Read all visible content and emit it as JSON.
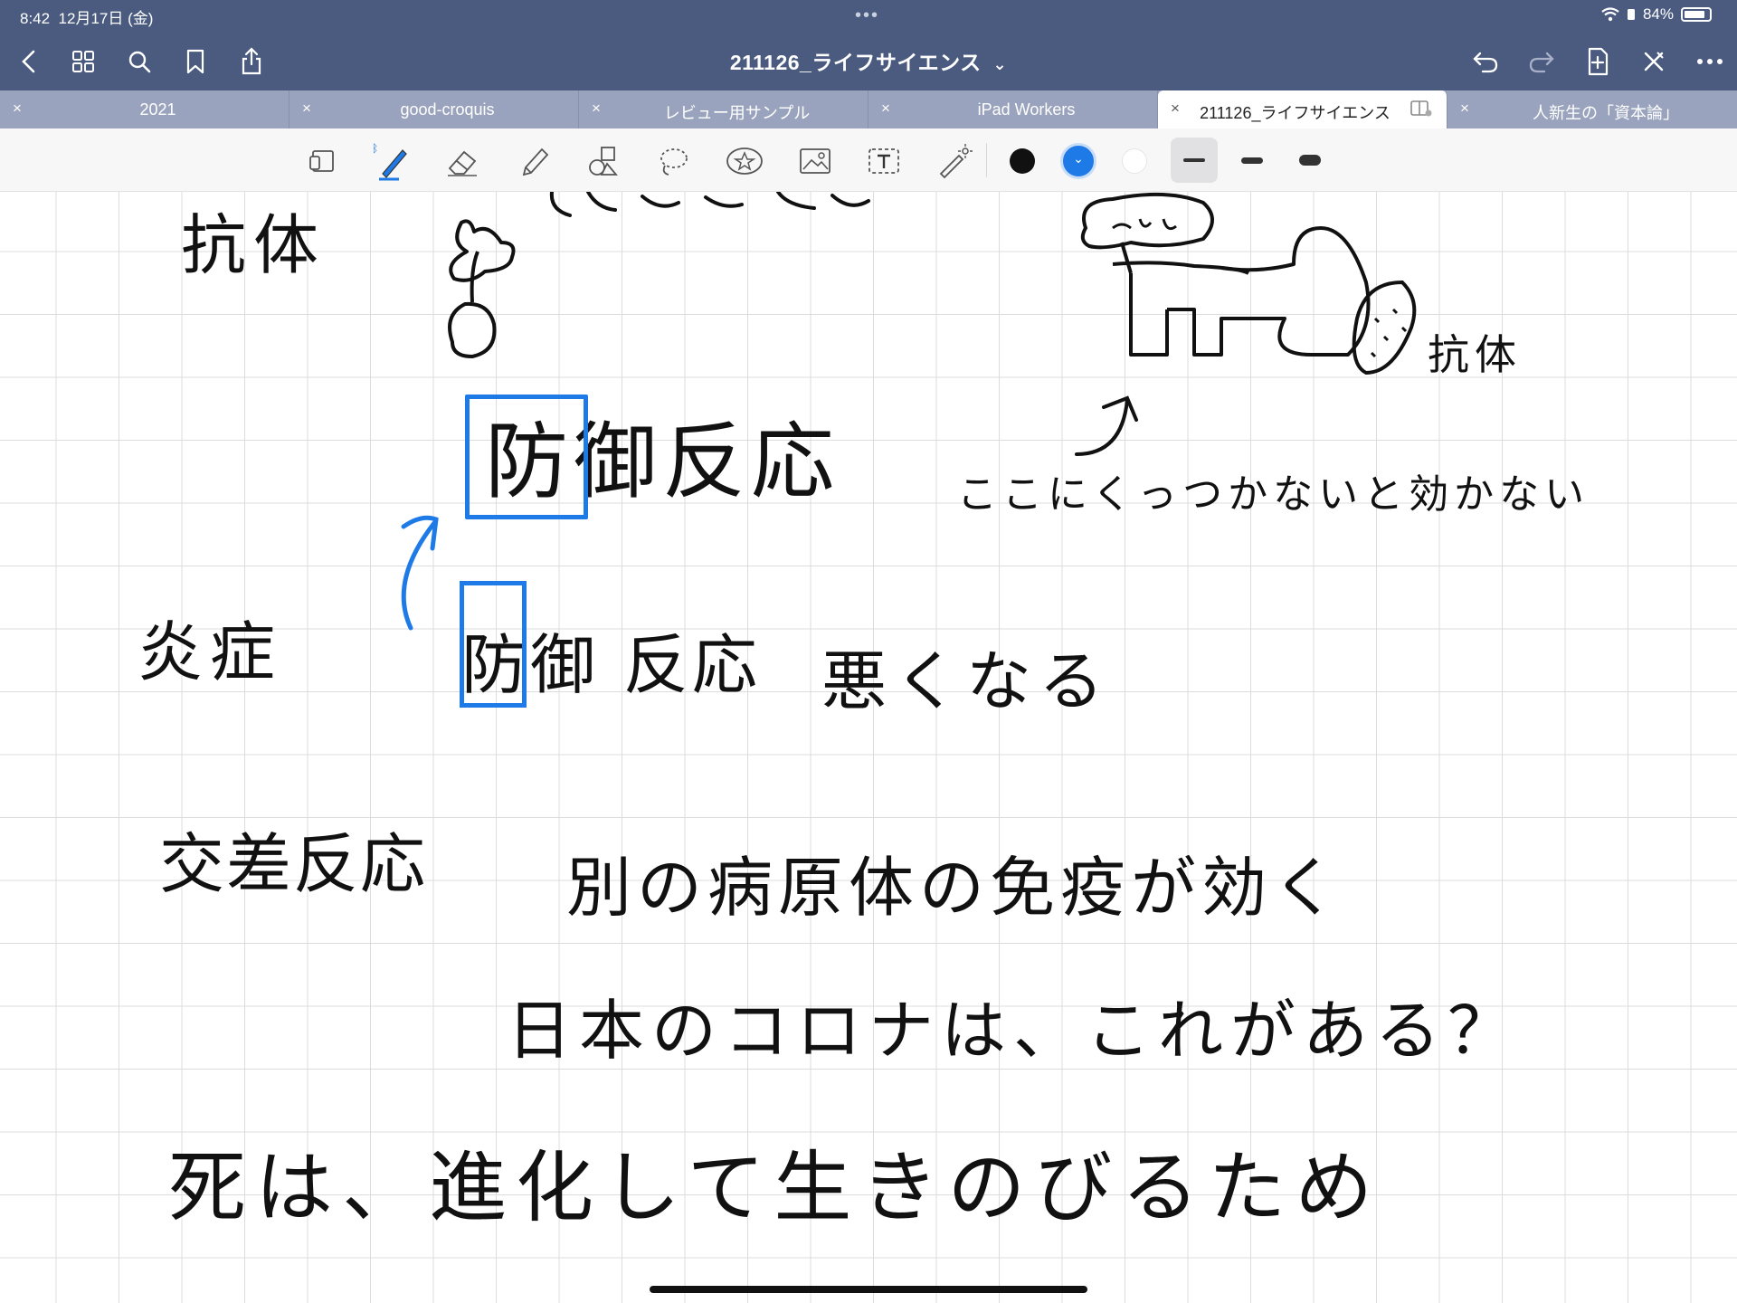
{
  "status": {
    "time": "8:42",
    "date": "12月17日 (金)",
    "battery": "84%",
    "battery_level": 0.84
  },
  "nav": {
    "title": "211126_ライフサイエンス",
    "title_chevron": "⌄"
  },
  "tabs": [
    {
      "label": "2021"
    },
    {
      "label": "good-croquis"
    },
    {
      "label": "レビュー用サンプル"
    },
    {
      "label": "iPad Workers"
    },
    {
      "label": "211126_ライフサイエンス",
      "active": true
    },
    {
      "label": "人新生の「資本論」"
    }
  ],
  "toolbar": {
    "colors": [
      "#111111",
      "#1e7ae6",
      "#ffffff"
    ],
    "selected_color": "#1e7ae6"
  },
  "notes": {
    "antibody_heading": "抗体",
    "defense_reaction_boxed": "防御反応",
    "here_note": "ここにくっつかないと効かない",
    "antibody_label": "抗体",
    "inflammation": "炎症",
    "defense_bad": "防御 反応",
    "bad": "悪くなる",
    "cross_reaction": "交差反応",
    "cross_explain": "別の病原体の免疫が効く",
    "japan_corona": "日本のコロナは、これがある？",
    "death_note": "死は、進化して生きのびるため"
  }
}
